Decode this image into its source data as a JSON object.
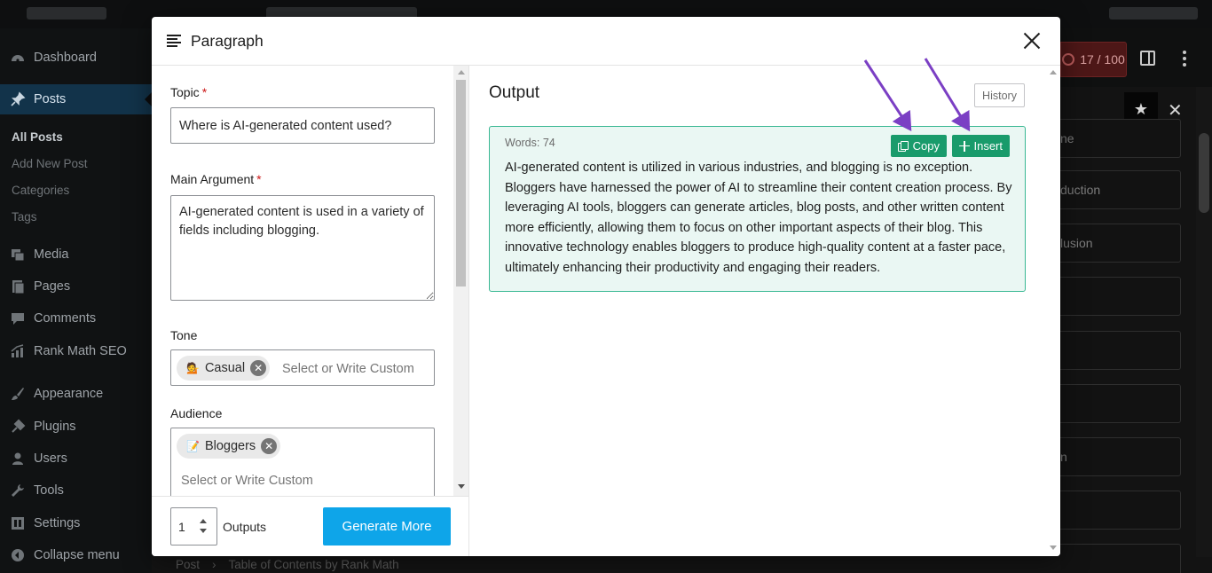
{
  "admin_menu": {
    "items": [
      {
        "label": "Dashboard",
        "icon": "dashboard-icon"
      },
      {
        "label": "Posts",
        "icon": "pin-icon"
      },
      {
        "label": "Media",
        "icon": "media-icon"
      },
      {
        "label": "Pages",
        "icon": "pages-icon"
      },
      {
        "label": "Comments",
        "icon": "comments-icon"
      },
      {
        "label": "Rank Math SEO",
        "icon": "rank-math-icon"
      },
      {
        "label": "Appearance",
        "icon": "brush-icon"
      },
      {
        "label": "Plugins",
        "icon": "plug-icon"
      },
      {
        "label": "Users",
        "icon": "user-icon"
      },
      {
        "label": "Tools",
        "icon": "wrench-icon"
      },
      {
        "label": "Settings",
        "icon": "settings-icon"
      },
      {
        "label": "Collapse menu",
        "icon": "collapse-icon"
      }
    ],
    "posts_submenu": [
      "All Posts",
      "Add New Post",
      "Categories",
      "Tags"
    ]
  },
  "editor_toolbar": {
    "seo_score": "17 / 100"
  },
  "side_panel": {
    "items": [
      "ne",
      "duction",
      "lusion",
      "",
      "",
      "",
      "",
      "n",
      "",
      ""
    ]
  },
  "breadcrumb": {
    "items": [
      "Post",
      "Table of Contents by Rank Math"
    ],
    "separator": "›"
  },
  "modal": {
    "title": "Paragraph",
    "form": {
      "topic": {
        "label": "Topic",
        "required_mark": "*",
        "value": "Where is AI-generated content used?"
      },
      "main_argument": {
        "label": "Main Argument",
        "required_mark": "*",
        "value": "AI-generated content is used in a variety of fields including blogging."
      },
      "tone": {
        "label": "Tone",
        "tokens": [
          {
            "emoji": "💁",
            "label": "Casual"
          }
        ],
        "placeholder": "Select or Write Custom"
      },
      "audience": {
        "label": "Audience",
        "tokens": [
          {
            "emoji": "📝",
            "label": "Bloggers"
          }
        ],
        "placeholder": "Select or Write Custom"
      }
    },
    "footer": {
      "outputs_value": "1",
      "outputs_label": "Outputs",
      "generate_label": "Generate More"
    },
    "output": {
      "title": "Output",
      "history_label": "History",
      "word_count": "Words: 74",
      "copy_label": "Copy",
      "insert_label": "Insert",
      "text": "AI-generated content is utilized in various industries, and blogging is no exception. Bloggers have harnessed the power of AI to streamline their content creation process. By leveraging AI tools, bloggers can generate articles, blog posts, and other written content more efficiently, allowing them to focus on other important aspects of their blog. This innovative technology enables bloggers to produce high-quality content at a faster pace, ultimately enhancing their productivity and engaging their readers."
    }
  },
  "colors": {
    "accent_green": "#199b6b",
    "generate_blue": "#0ea5e9",
    "annotation_arrow": "#7b3fc4",
    "output_card_bg": "#eaf7f3"
  }
}
